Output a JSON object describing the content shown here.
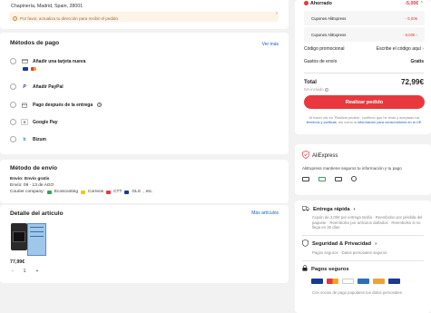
{
  "address": {
    "line": "Chapinería, Madrid, Spain, 28001",
    "warning": "Por favor, actualiza tu dirección para recibir el pedido"
  },
  "payment": {
    "title": "Métodos de pago",
    "see_more": "Ver más",
    "options": [
      {
        "label": "Añadir una tarjeta nueva"
      },
      {
        "label": "Añadir PayPal"
      },
      {
        "label": "Pago después de la entrega"
      },
      {
        "label": "Google Pay"
      },
      {
        "label": "Bizum"
      }
    ]
  },
  "shipping": {
    "title": "Método de envío",
    "method": "Envío: Envío gratis",
    "dates": "Envío: 09 - 13 de AGO",
    "courier_label": "Courier company:",
    "couriers": [
      "Ecoscooting",
      "Correos",
      "CTT",
      "GLS",
      ", etc."
    ]
  },
  "items": {
    "title": "Detalle del artículo",
    "see_more": "Más artículos",
    "price": "77,99€",
    "qty_minus": "-",
    "qty": "1",
    "qty_plus": "+"
  },
  "summary": {
    "saved_label": "Ahorrado",
    "saved_value": "-5,00€",
    "coupon1_label": "Cupones AliExpress",
    "coupon1_value": "- 5,00€",
    "coupon2_label": "Cupones AliExpress",
    "coupon2_value": "- 5,00€",
    "promo_label": "Código promocional",
    "promo_value": "Escribe el código aquí",
    "shipping_label": "Gastos de envío",
    "shipping_value": "Gratis",
    "total_label": "Total",
    "total_value": "72,99€",
    "iva": "IVA incluido",
    "cta": "Realizar pedido",
    "legal_prefix": "Al hacer clic en 'Realizar pedido', confirmo que he leído y aceptado los",
    "legal_link1": "términos y políticas",
    "legal_mid": ", así como la",
    "legal_link2": "información para consumidores en la UE",
    "legal_end": "."
  },
  "aliexpress": {
    "brand": "AliExpress",
    "desc": "AliExpress mantiene seguros tu información y tu pago"
  },
  "benefits": {
    "fast_title": "Entrega rápida",
    "fast_text": "Cupón de 3,00€ por entrega tardía · Reembolso por pérdida del paquete · Reembolso por artículos dañados · Reembolso si no llega en 30 días",
    "sec_title": "Seguridad & Privacidad",
    "sec_text": "Pagos seguros · Datos personales seguros",
    "pay_title": "Pagos seguros",
    "pay_text": "Con socios de pago populares tus datos personales"
  },
  "colors": {
    "accent": "#e8383d",
    "link": "#1a5ecb",
    "success": "#2a9d4a"
  }
}
